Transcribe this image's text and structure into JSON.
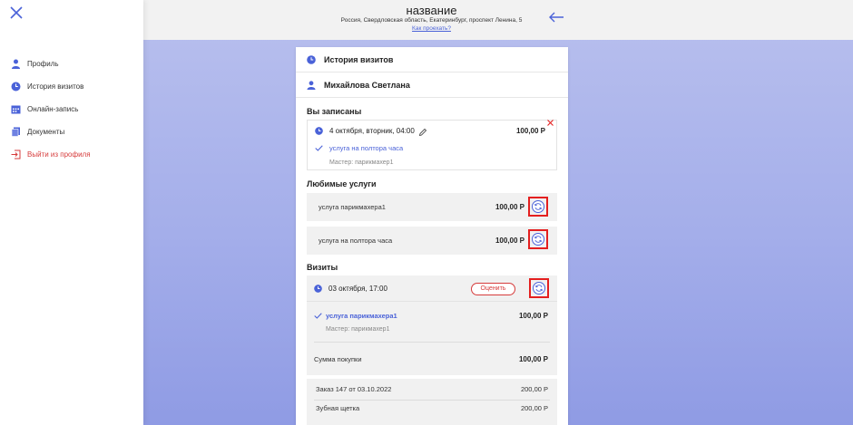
{
  "sidebar": {
    "items": [
      {
        "label": "Профиль",
        "icon": "user-icon"
      },
      {
        "label": "История визитов",
        "icon": "clock-icon"
      },
      {
        "label": "Онлайн-запись",
        "icon": "calendar-icon"
      },
      {
        "label": "Документы",
        "icon": "documents-icon"
      },
      {
        "label": "Выйти из профиля",
        "icon": "logout-icon"
      }
    ]
  },
  "header": {
    "title": "название",
    "address": "Россия, Свердловская область, Екатеринбург, проспект Ленина, 5",
    "route_link": "Как проехать?"
  },
  "card": {
    "history_title": "История визитов",
    "client_name": "Михайлова Светлана",
    "booked": {
      "section_title": "Вы записаны",
      "date": "4 октября, вторник, 04:00",
      "price": "100,00 Р",
      "service": "услуга на полтора часа",
      "master": "Мастер: парикмахер1"
    },
    "favorites": {
      "section_title": "Любимые услуги",
      "items": [
        {
          "name": "услуга парикмахера1",
          "price": "100,00 Р"
        },
        {
          "name": "услуга на полтора часа",
          "price": "100,00 Р"
        }
      ]
    },
    "visits": {
      "section_title": "Визиты",
      "date": "03 октября, 17:00",
      "rate_label": "Оценить",
      "service": "услуга парикмахера1",
      "service_price": "100,00 Р",
      "master": "Мастер: парикмахер1",
      "sum_label": "Сумма покупки",
      "sum_value": "100,00 Р"
    },
    "order": {
      "title": "Заказ 147 от 03.10.2022",
      "title_value": "200,00 Р",
      "item": "Зубная щетка",
      "item_value": "200,00 Р"
    }
  },
  "colors": {
    "accent": "#4a62d8",
    "danger": "#d63b3b",
    "highlight": "#e41f1f"
  }
}
